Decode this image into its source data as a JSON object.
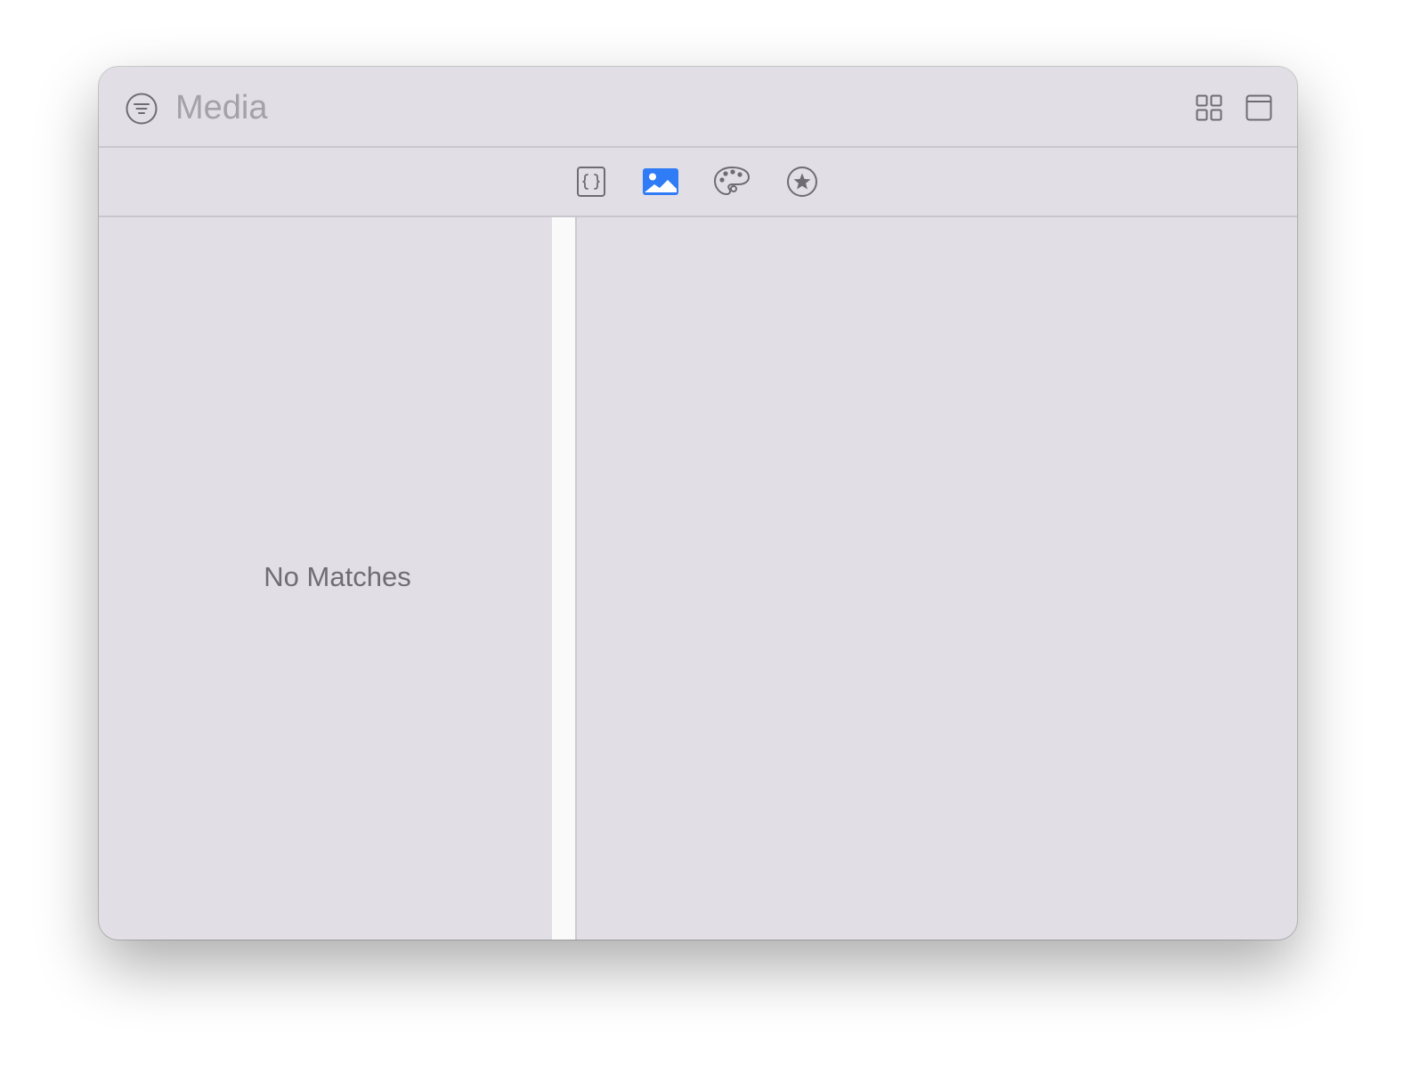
{
  "titlebar": {
    "search_placeholder": "Media",
    "filter_icon": "filter-circle-icon",
    "grid_view_icon": "grid-view-icon",
    "window_icon": "window-icon"
  },
  "tabs": [
    {
      "name": "code-snippets",
      "icon": "curly-braces-icon",
      "selected": false
    },
    {
      "name": "media",
      "icon": "photo-icon",
      "selected": true
    },
    {
      "name": "colors",
      "icon": "palette-icon",
      "selected": false
    },
    {
      "name": "symbols",
      "icon": "star-circle-icon",
      "selected": false
    }
  ],
  "results": {
    "empty_text": "No Matches"
  },
  "colors": {
    "accent": "#2f7cf6",
    "icon_gray": "#6e6b73",
    "window_bg": "#e1dee6"
  }
}
